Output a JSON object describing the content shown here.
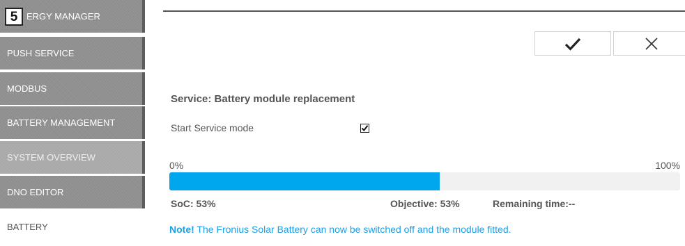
{
  "step_badge": "5",
  "sidebar": {
    "items": [
      {
        "label": "ERGY MANAGER"
      },
      {
        "label": "PUSH SERVICE"
      },
      {
        "label": "MODBUS"
      },
      {
        "label": "BATTERY MANAGEMENT"
      },
      {
        "label": "SYSTEM OVERVIEW"
      },
      {
        "label": "DNO EDITOR"
      },
      {
        "label": "BATTERY"
      }
    ],
    "active_label": "BATTERY"
  },
  "toolbar": {
    "confirm_icon": "checkmark-icon",
    "cancel_icon": "close-icon"
  },
  "service": {
    "title": "Service: Battery module replacement",
    "mode_label": "Start Service mode",
    "mode_checked": true
  },
  "progress": {
    "min_label": "0%",
    "max_label": "100%",
    "value": 53,
    "soc_text": "SoC: 53%",
    "objective_text": "Objective: 53%",
    "remaining_text": "Remaining time:--"
  },
  "note": {
    "prefix": "Note!",
    "text": " The Fronius Solar Battery can now be switched off and the module fitted."
  },
  "colors": {
    "accent": "#00a6ee",
    "note": "#1aa0e8",
    "nav_bg": "#8e8e8e"
  }
}
